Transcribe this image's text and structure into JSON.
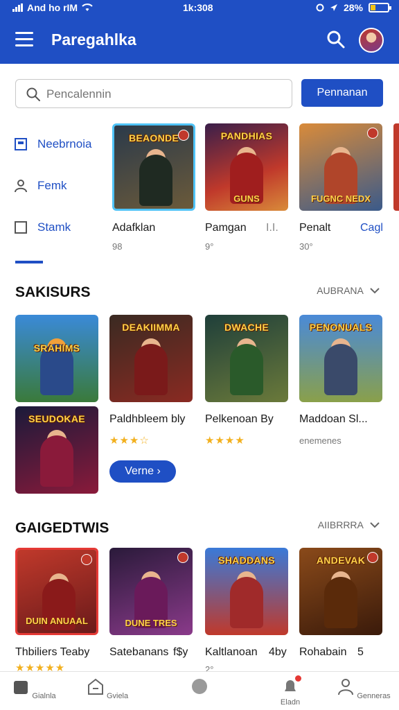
{
  "status": {
    "carrier": "And ho rIM",
    "time": "1k:308",
    "battery": "28%",
    "battery_level": 0.28
  },
  "header": {
    "title": "Paregahlka",
    "menu_icon": "hamburger-icon",
    "search_icon": "search-icon"
  },
  "search": {
    "placeholder": "Pencalennin",
    "button_label": "Pennanan"
  },
  "side_nav": [
    {
      "label": "Neebrnoia",
      "icon": "calendar-icon",
      "active": true
    },
    {
      "label": "Femk",
      "icon": "person-icon",
      "active": false
    },
    {
      "label": "Stamk",
      "icon": "square-icon",
      "active": false
    }
  ],
  "featured": [
    {
      "title": "Adafklan",
      "sub": "98",
      "art": "BEAONDE",
      "art_sub": "",
      "colors": [
        "#2b3a4a",
        "#6b5a3a"
      ]
    },
    {
      "title": "Pamgan",
      "sub": "9°",
      "extra": "I.I.",
      "art": "PANDHIAS",
      "art_sub": "GUNS",
      "colors": [
        "#3a1f4a",
        "#c0392b"
      ]
    },
    {
      "title": "Penalt",
      "sub": "30°",
      "extra": "Cagl",
      "art": "",
      "art_sub": "FUGNC NEDX",
      "colors": [
        "#d98b3a",
        "#3a5a8a"
      ]
    }
  ],
  "sections": [
    {
      "title": "SAKISURS",
      "more": "AUBRANA",
      "more_button": "Verne",
      "cards": [
        {
          "title": "",
          "art": "SRAHIMS",
          "art_sub": "",
          "colors": [
            "#3a8ad8",
            "#3a7a3a"
          ]
        },
        {
          "title": "Paldhbleem bly",
          "stars": "★★★☆",
          "art": "DEAKIIMMA",
          "art_sub": "",
          "colors": [
            "#3a2a22",
            "#8a2a22"
          ]
        },
        {
          "title": "Pelkenoan By",
          "stars": "★★★★",
          "art": "DWACHE",
          "art_sub": "",
          "colors": [
            "#1f3f3a",
            "#6b7a3a"
          ]
        },
        {
          "title": "Maddoan Sl...",
          "sub": "enemenes",
          "art": "PENONUALS",
          "art_sub": "",
          "colors": [
            "#4a8ad8",
            "#8aa04a"
          ]
        }
      ],
      "extra_card": {
        "art": "SEUDOKAE",
        "colors": [
          "#1a1a3a",
          "#8a1a3a"
        ]
      }
    },
    {
      "title": "GAIGEDTWIS",
      "more": "AIIBRRRA",
      "cards": [
        {
          "title": "Thbiliers Teaby",
          "stars": "★★★★★",
          "art": "",
          "art_sub": "DUIN ANUAAL",
          "colors": [
            "#c0392b",
            "#6a1a1a"
          ]
        },
        {
          "title": "Satebanans",
          "extra": "f$y",
          "art": "",
          "art_sub": "DUNE TRES",
          "colors": [
            "#2a1a3a",
            "#8a3a8a"
          ]
        },
        {
          "title": "Kaltlanoan",
          "extra": "4by",
          "sub": "2°",
          "art": "SHADDANS",
          "art_sub": "",
          "colors": [
            "#3a7ad8",
            "#c0392b"
          ]
        },
        {
          "title": "Rohabain",
          "extra": "5",
          "sub": "",
          "art": "ANDEVAK",
          "art_sub": "",
          "colors": [
            "#8a4a1a",
            "#3a1a0a"
          ]
        }
      ]
    }
  ],
  "bottom_nav": [
    {
      "label": "Gialnla",
      "icon": "home-icon"
    },
    {
      "label": "Gviela",
      "icon": "store-icon"
    },
    {
      "label": "",
      "icon": "circle-icon"
    },
    {
      "label": "Eladn",
      "icon": "bell-icon",
      "badge": true
    },
    {
      "label": "Genneras",
      "icon": "profile-icon"
    }
  ],
  "colors": {
    "brand": "#1f4fc4",
    "star": "#f2b01e"
  }
}
